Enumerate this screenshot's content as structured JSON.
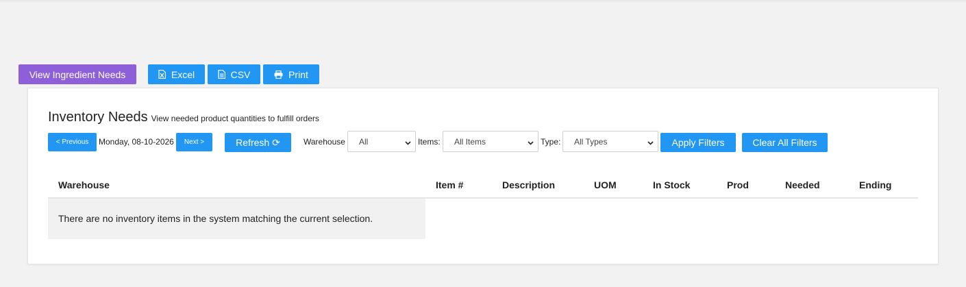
{
  "toolbar": {
    "view_ingredient_needs": "View Ingredient Needs",
    "excel": "Excel",
    "csv": "CSV",
    "print": "Print"
  },
  "page": {
    "title": "Inventory Needs",
    "subtitle": "View needed product quantities to fulfill orders"
  },
  "filters": {
    "previous": "< Previous",
    "date": "Monday, 08-10-2026",
    "next": "Next >",
    "refresh": "Refresh ⟳",
    "warehouse_label": "Warehouse",
    "warehouse_value": "All",
    "items_label": "Items:",
    "items_value": "All Items",
    "type_label": "Type:",
    "type_value": "All Types",
    "apply": "Apply Filters",
    "clear": "Clear All Filters"
  },
  "table": {
    "columns": [
      "Warehouse",
      "Item #",
      "Description",
      "UOM",
      "In Stock",
      "Prod",
      "Needed",
      "Ending"
    ],
    "empty_message": "There are no inventory items in the system matching the current selection."
  },
  "colors": {
    "primary": "#2196f3",
    "purple": "#8d5fd9"
  },
  "icons": {
    "excel": "file-excel-icon",
    "csv": "file-text-icon",
    "print": "printer-icon",
    "select": "chevron-down-icon"
  }
}
